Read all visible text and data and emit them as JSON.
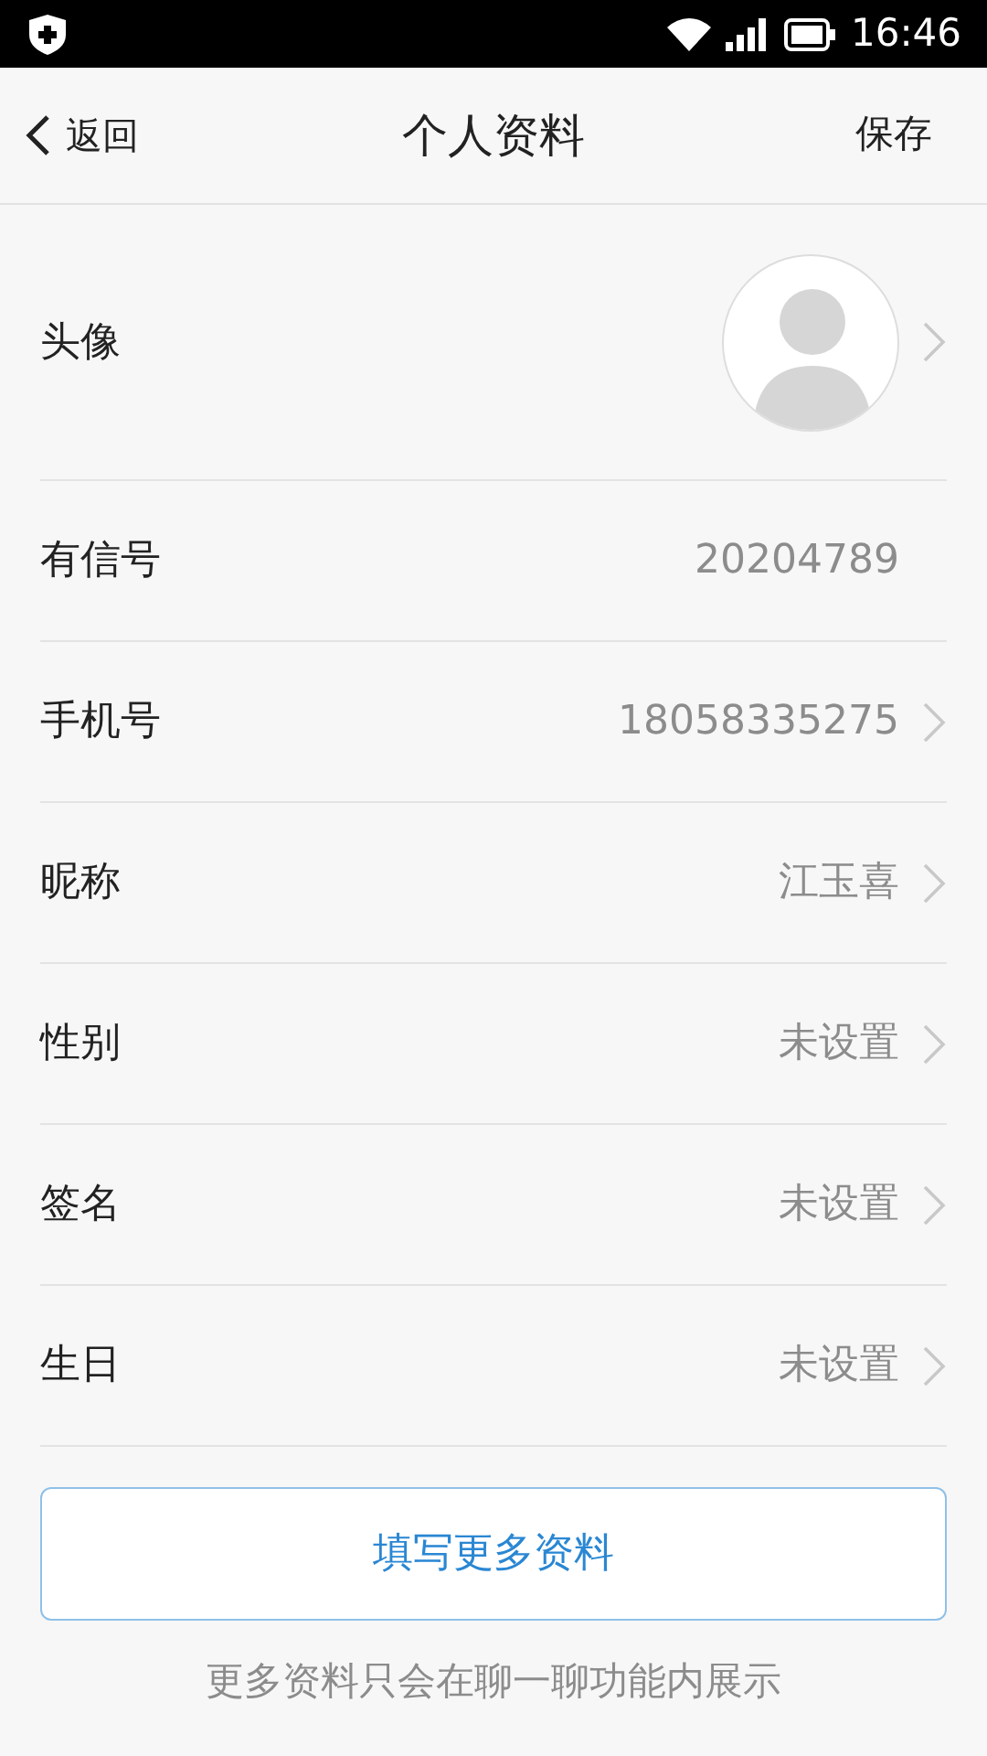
{
  "status_bar": {
    "time": "16:46"
  },
  "nav": {
    "back": "返回",
    "title": "个人资料",
    "action": "保存"
  },
  "rows": [
    {
      "kind": "avatar",
      "label": "头像",
      "chevron": true
    },
    {
      "kind": "text",
      "label": "有信号",
      "value": "20204789",
      "chevron": false
    },
    {
      "kind": "text",
      "label": "手机号",
      "value": "18058335275",
      "chevron": true
    },
    {
      "kind": "text",
      "label": "昵称",
      "value": "江玉喜",
      "chevron": true
    },
    {
      "kind": "text",
      "label": "性别",
      "value": "未设置",
      "chevron": true
    },
    {
      "kind": "text",
      "label": "签名",
      "value": "未设置",
      "chevron": true
    },
    {
      "kind": "text",
      "label": "生日",
      "value": "未设置",
      "chevron": true
    }
  ],
  "more_button": "填写更多资料",
  "footnote": "更多资料只会在聊一聊功能内展示"
}
